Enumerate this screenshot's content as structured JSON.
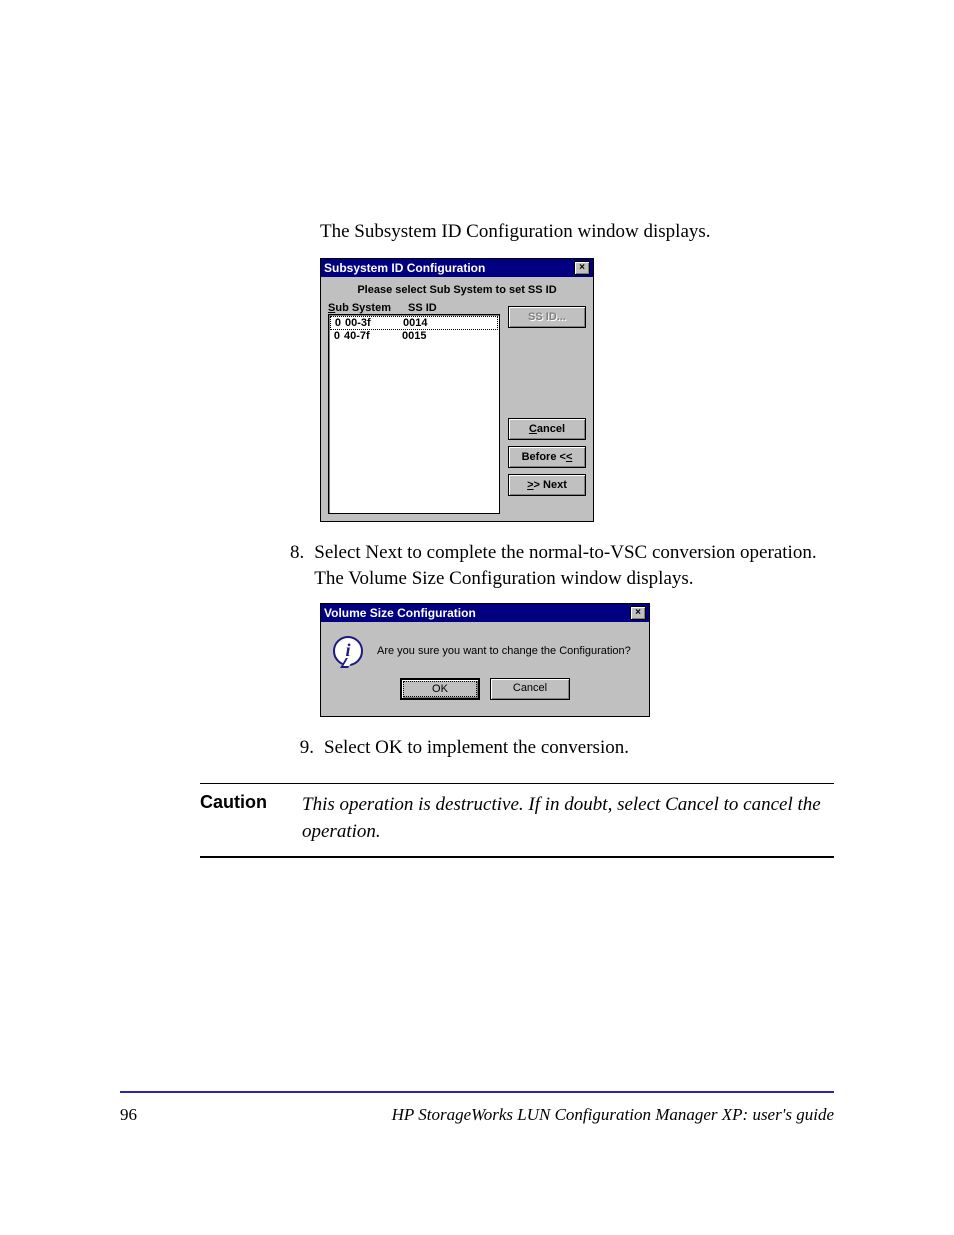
{
  "intro_text": "The Subsystem ID Configuration window displays.",
  "dialog1": {
    "title": "Subsystem ID Configuration",
    "close_glyph": "×",
    "instruction": "Please select Sub System to set SS ID",
    "header_subsystem": "Sub System",
    "header_ssid": "SS ID",
    "rows": [
      {
        "col1": "0",
        "col2": "00-3f",
        "col3": "0014",
        "selected": true
      },
      {
        "col1": "0",
        "col2": "40-7f",
        "col3": "0015",
        "selected": false
      }
    ],
    "btn_ssid": "SS ID...",
    "btn_cancel_pre": "",
    "btn_cancel_u": "C",
    "btn_cancel_post": "ancel",
    "btn_before_pre": "Before <",
    "btn_before_u": "<",
    "btn_next_u": ">",
    "btn_next_post": "> Next"
  },
  "step8_num": "8.",
  "step8_text": "Select Next to complete the normal-to-VSC conversion operation. The Volume Size Configuration window displays.",
  "dialog2": {
    "title": "Volume Size Configuration",
    "close_glyph": "×",
    "info_glyph": "i",
    "message": "Are you sure you want to change the Configuration?",
    "btn_ok": "OK",
    "btn_cancel": "Cancel"
  },
  "step9_num": "9.",
  "step9_text": "Select OK to implement the conversion.",
  "caution": {
    "label": "Caution",
    "text": "This operation is destructive. If in doubt, select Cancel to cancel the operation."
  },
  "footer": {
    "page": "96",
    "guide": "HP StorageWorks LUN Configuration Manager XP: user's guide"
  }
}
